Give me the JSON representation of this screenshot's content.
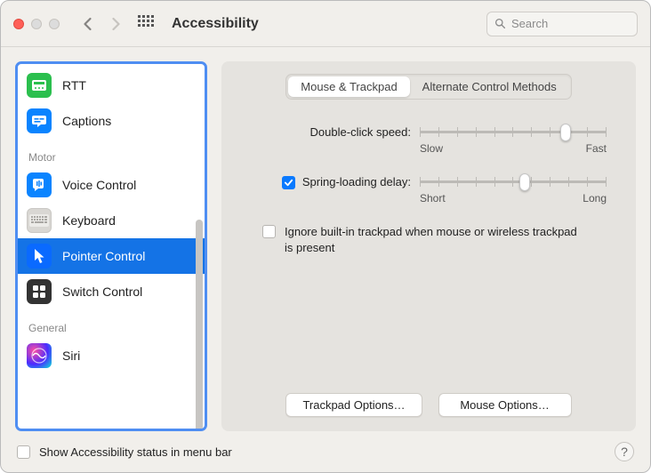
{
  "window": {
    "title": "Accessibility"
  },
  "search": {
    "placeholder": "Search"
  },
  "sidebar": {
    "items": [
      {
        "label": "RTT"
      },
      {
        "label": "Captions"
      }
    ],
    "motor_label": "Motor",
    "motor": [
      {
        "label": "Voice Control"
      },
      {
        "label": "Keyboard"
      },
      {
        "label": "Pointer Control"
      },
      {
        "label": "Switch Control"
      }
    ],
    "general_label": "General",
    "general": [
      {
        "label": "Siri"
      }
    ]
  },
  "tabs": {
    "mouse_trackpad": "Mouse & Trackpad",
    "alt_methods": "Alternate Control Methods"
  },
  "settings": {
    "double_click_label": "Double-click speed:",
    "double_click_min": "Slow",
    "double_click_max": "Fast",
    "spring_label": "Spring-loading delay:",
    "spring_min": "Short",
    "spring_max": "Long",
    "ignore_trackpad": "Ignore built-in trackpad when mouse or wireless trackpad is present"
  },
  "buttons": {
    "trackpad_options": "Trackpad Options…",
    "mouse_options": "Mouse Options…"
  },
  "footer": {
    "menubar_label": "Show Accessibility status in menu bar"
  }
}
